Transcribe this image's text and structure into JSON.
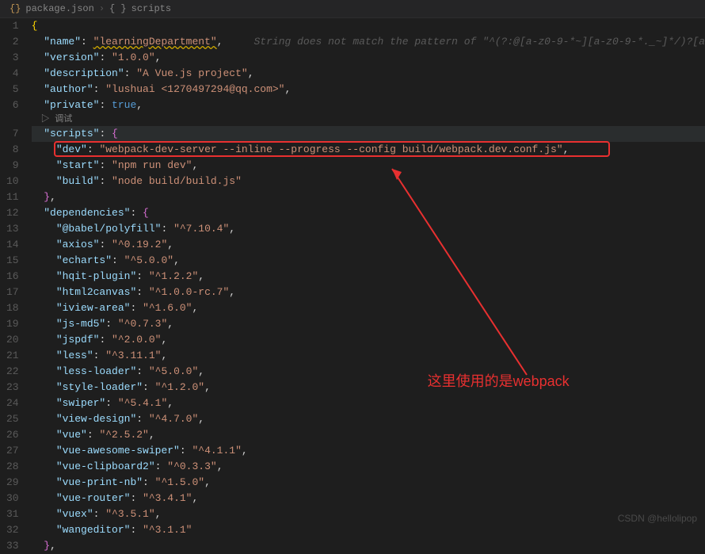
{
  "breadcrumb": {
    "file": "package.json",
    "path": "scripts"
  },
  "codelens": {
    "debug": "调试"
  },
  "code": {
    "name_key": "\"name\"",
    "name_val": "\"learningDepartment\"",
    "name_warn": "String does not match the pattern of \"^(?:@[a-z0-9-*~][a-z0-9-*._~]*/)?[a",
    "version_key": "\"version\"",
    "version_val": "\"1.0.0\"",
    "description_key": "\"description\"",
    "description_val": "\"A Vue.js project\"",
    "author_key": "\"author\"",
    "author_val": "\"lushuai <1270497294@qq.com>\"",
    "private_key": "\"private\"",
    "private_val": "true",
    "scripts_key": "\"scripts\"",
    "dev_key": "\"dev\"",
    "dev_val": "\"webpack-dev-server --inline --progress --config build/webpack.dev.conf.js\"",
    "start_key": "\"start\"",
    "start_val": "\"npm run dev\"",
    "build_key": "\"build\"",
    "build_val": "\"node build/build.js\"",
    "dependencies_key": "\"dependencies\"",
    "deps": {
      "babel_polyfill_k": "\"@babel/polyfill\"",
      "babel_polyfill_v": "\"^7.10.4\"",
      "axios_k": "\"axios\"",
      "axios_v": "\"^0.19.2\"",
      "echarts_k": "\"echarts\"",
      "echarts_v": "\"^5.0.0\"",
      "hqit_plugin_k": "\"hqit-plugin\"",
      "hqit_plugin_v": "\"^1.2.2\"",
      "html2canvas_k": "\"html2canvas\"",
      "html2canvas_v": "\"^1.0.0-rc.7\"",
      "iview_area_k": "\"iview-area\"",
      "iview_area_v": "\"^1.6.0\"",
      "js_md5_k": "\"js-md5\"",
      "js_md5_v": "\"^0.7.3\"",
      "jspdf_k": "\"jspdf\"",
      "jspdf_v": "\"^2.0.0\"",
      "less_k": "\"less\"",
      "less_v": "\"^3.11.1\"",
      "less_loader_k": "\"less-loader\"",
      "less_loader_v": "\"^5.0.0\"",
      "style_loader_k": "\"style-loader\"",
      "style_loader_v": "\"^1.2.0\"",
      "swiper_k": "\"swiper\"",
      "swiper_v": "\"^5.4.1\"",
      "view_design_k": "\"view-design\"",
      "view_design_v": "\"^4.7.0\"",
      "vue_k": "\"vue\"",
      "vue_v": "\"^2.5.2\"",
      "vue_awesome_swiper_k": "\"vue-awesome-swiper\"",
      "vue_awesome_swiper_v": "\"^4.1.1\"",
      "vue_clipboard2_k": "\"vue-clipboard2\"",
      "vue_clipboard2_v": "\"^0.3.3\"",
      "vue_print_nb_k": "\"vue-print-nb\"",
      "vue_print_nb_v": "\"^1.5.0\"",
      "vue_router_k": "\"vue-router\"",
      "vue_router_v": "\"^3.4.1\"",
      "vuex_k": "\"vuex\"",
      "vuex_v": "\"^3.5.1\"",
      "wangeditor_k": "\"wangeditor\"",
      "wangeditor_v": "\"^3.1.1\""
    }
  },
  "annotation": {
    "text": "这里使用的是webpack"
  },
  "watermark": {
    "text": "CSDN @hellolipop"
  },
  "line_numbers": [
    "1",
    "2",
    "3",
    "4",
    "5",
    "6",
    "",
    "7",
    "8",
    "9",
    "10",
    "11",
    "12",
    "13",
    "14",
    "15",
    "16",
    "17",
    "18",
    "19",
    "20",
    "21",
    "22",
    "23",
    "24",
    "25",
    "26",
    "27",
    "28",
    "29",
    "30",
    "31",
    "32",
    "33"
  ]
}
